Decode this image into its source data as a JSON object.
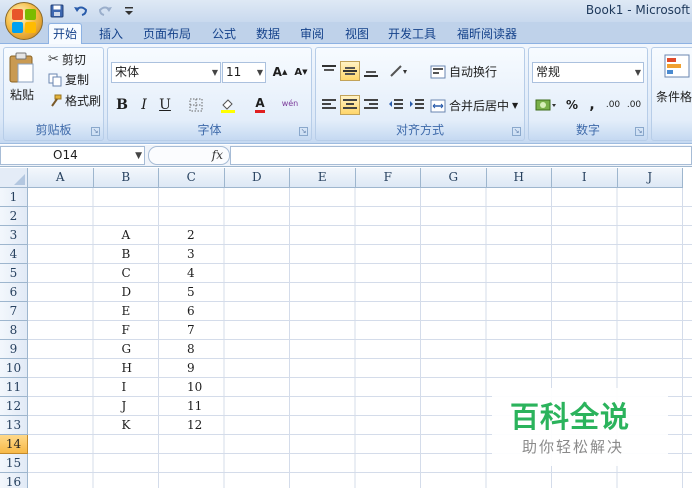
{
  "window": {
    "title": "Book1 - Microsoft"
  },
  "colors": {
    "accent": "#15428b",
    "watermark": "#2bb35c",
    "selected_row": "#f7b948"
  },
  "tabs": [
    {
      "label": "开始",
      "active": true
    },
    {
      "label": "插入"
    },
    {
      "label": "页面布局"
    },
    {
      "label": "公式"
    },
    {
      "label": "数据"
    },
    {
      "label": "审阅"
    },
    {
      "label": "视图"
    },
    {
      "label": "开发工具"
    },
    {
      "label": "福昕阅读器"
    }
  ],
  "ribbon": {
    "clipboard": {
      "group_label": "剪贴板",
      "paste": "粘贴",
      "cut": "剪切",
      "copy": "复制",
      "format_painter": "格式刷"
    },
    "font": {
      "group_label": "字体",
      "font_name": "宋体",
      "font_size": "11",
      "grow": "A",
      "shrink": "A",
      "bold": "B",
      "italic": "I",
      "underline": "U",
      "font_color_glyph": "A",
      "phonetic": "wén"
    },
    "alignment": {
      "group_label": "对齐方式",
      "wrap_text": "自动换行",
      "merge_center": "合并后居中"
    },
    "number": {
      "group_label": "数字",
      "format": "常规",
      "percent": "%",
      "comma": ",",
      "inc_decimal": ".00",
      "dec_decimal": ".00"
    },
    "styles": {
      "conditional": "条件格"
    }
  },
  "formula_bar": {
    "name_box": "O14",
    "fx": "fx",
    "value": ""
  },
  "columns": [
    "A",
    "B",
    "C",
    "D",
    "E",
    "F",
    "G",
    "H",
    "I",
    "J"
  ],
  "rows": [
    "1",
    "2",
    "3",
    "4",
    "5",
    "6",
    "7",
    "8",
    "9",
    "10",
    "11",
    "12",
    "13",
    "14",
    "15",
    "16"
  ],
  "selected_row": "14",
  "cells": {
    "B3": "A",
    "C3": "2",
    "B4": "B",
    "C4": "3",
    "B5": "C",
    "C5": "4",
    "B6": "D",
    "C6": "5",
    "B7": "E",
    "C7": "6",
    "B8": "F",
    "C8": "7",
    "B9": "G",
    "C9": "8",
    "B10": "H",
    "C10": "9",
    "B11": "I",
    "C11": "10",
    "B12": "J",
    "C12": "11",
    "B13": "K",
    "C13": "12"
  },
  "watermark": {
    "title": "百科全说",
    "subtitle": "助你轻松解决"
  }
}
